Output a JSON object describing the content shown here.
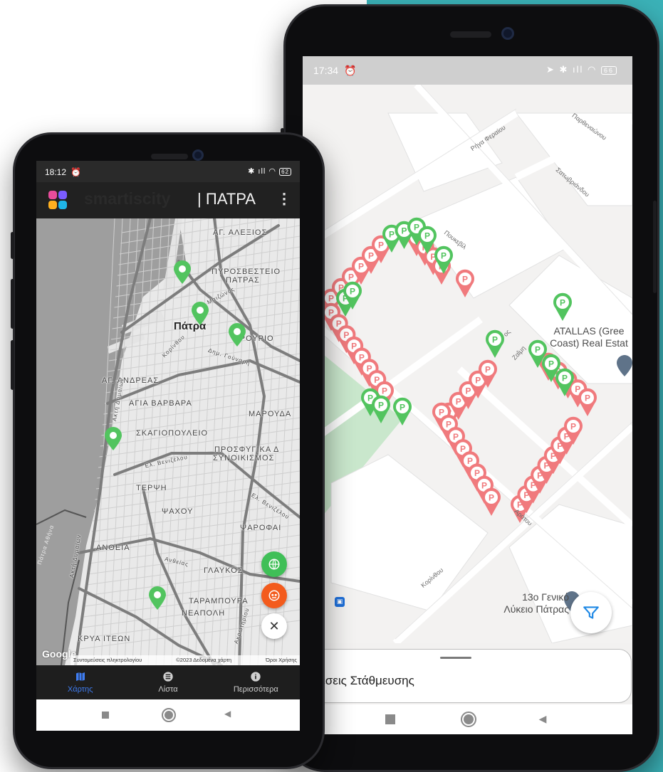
{
  "colors": {
    "teal_background": "#3bb2b8",
    "marker_free": "#52c45f",
    "marker_occupied": "#f07a7d",
    "accent_blue": "#3f7df2",
    "fab_green": "#3fbf57",
    "fab_orange": "#f35b1d"
  },
  "right_phone": {
    "status_bar": {
      "time": "17:34",
      "battery": "66"
    },
    "map": {
      "streets": [
        "Παρθεναώνου",
        "Ρήγα Φεραίου",
        "Σατωβριάνδου",
        "Πουκεβίλ",
        "Ζαΐμη",
        "Αράτου",
        "Κορίνθου",
        "ος"
      ],
      "poi": [
        {
          "name": "ATALLAS (Green Coast) Real Estate",
          "line1": "ATALLAS (Gree",
          "line2": "Coast) Real Estat"
        },
        {
          "name": "13ο Γενικό Λύκειο Πάτρας",
          "line1": "13ο Γενικό",
          "line2": "Λύκειο Πάτρας"
        }
      ],
      "marker_letter": "P"
    },
    "filter_icon": "filter-icon",
    "bottom_sheet": {
      "title": "Θέσεις Στάθμευσης"
    }
  },
  "left_phone": {
    "status_bar": {
      "time": "18:12",
      "battery": "62"
    },
    "app_bar": {
      "brand": "smartiscity",
      "city": "| ΠΑΤΡΑ"
    },
    "map": {
      "labels": {
        "ag_alexios": "ΑΓ. ΑΛΕΞΙΟΣ",
        "pyrosvesteio_1": "ΠΥΡΟΣΒΕΣΤΕΙΟ",
        "pyrosvesteio_2": "ΠΑΤΡΑΣ",
        "patra": "Πάτρα",
        "frourio": "ΦΡΟΥΡΙΟ",
        "ag_andreas": "ΑΓ. ΑΝΔΡΕΑΣ",
        "agia_varvara": "ΑΓΙΑ ΒΑΡΒΑΡΑ",
        "maroudas": "ΜΑΡΟΥΔΑ",
        "skagiopouleio": "ΣΚΑΓΙΟΠΟΥΛΕΙΟ",
        "prosfygika_1": "ΠΡΟΣΦΥΓΙΚΑ Δ",
        "prosfygika_2": "ΣΥΝΟΙΚΙΣΜΟΣ",
        "terpsi": "ΤΕΡΨΗ",
        "psaxou": "ΨΑΧΟΥ",
        "psarofai": "ΨΑΡΟΦΑΙ",
        "anthia": "ΑΝΘΕΙΑ",
        "glafkos": "ΓΛΑΥΚΟΣ",
        "tarampoura": "ΤΑΡΑΜΠΟΥΡΑ",
        "neapoli": "ΝΕΑΠΟΛΗ",
        "krya_iteon": "ΚΡΥΑ ΙΤΕΩΝ",
        "street_kanakari": "Ελ. Βενιζέλου",
        "street_korinthou": "Κορίνθου",
        "street_maizonos": "Μαιζώνος",
        "street_gounari": "Δημ. Γούναρη",
        "street_akti": "Ακτή Δυμαίων",
        "street_akrotiriou": "Ακρωτηρίου",
        "street_anthias": "Ανθείας",
        "street_patra_athina": "Πάτρα Αθήνα"
      }
    },
    "fabs": {
      "globe": "globe-icon",
      "parking": "parking-icon",
      "close": "✕"
    },
    "attribution": {
      "google": "Google",
      "shortcuts": "Συντομεύσεις πληκτρολογίου",
      "data": "©2023 Δεδομένα χάρτη",
      "terms": "Όροι Χρήσης"
    },
    "bottom_nav": [
      {
        "label": "Χάρτης",
        "icon": "map-icon",
        "active": true
      },
      {
        "label": "Λίστα",
        "icon": "list-icon",
        "active": false
      },
      {
        "label": "Περισσότερα",
        "icon": "info-icon",
        "active": false
      }
    ]
  }
}
